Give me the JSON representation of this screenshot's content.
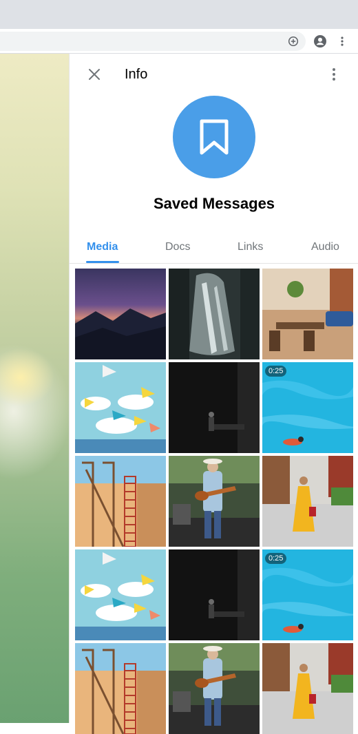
{
  "info": {
    "title": "Info",
    "name": "Saved Messages"
  },
  "tabs": [
    {
      "label": "Media",
      "active": true
    },
    {
      "label": "Docs",
      "active": false
    },
    {
      "label": "Links",
      "active": false
    },
    {
      "label": "Audio",
      "active": false
    }
  ],
  "media": [
    {
      "kind": "photo",
      "subject": "purple mountain sunset"
    },
    {
      "kind": "photo",
      "subject": "waterfall in forest"
    },
    {
      "kind": "photo",
      "subject": "restaurant interior"
    },
    {
      "kind": "photo",
      "subject": "colorful umbrellas in sky"
    },
    {
      "kind": "photo",
      "subject": "person in dark alley"
    },
    {
      "kind": "video",
      "subject": "swimmer in turquoise water",
      "duration": "0:25"
    },
    {
      "kind": "photo",
      "subject": "building with fire escape"
    },
    {
      "kind": "photo",
      "subject": "guitarist on stage"
    },
    {
      "kind": "photo",
      "subject": "woman in yellow dress on street"
    },
    {
      "kind": "photo",
      "subject": "colorful umbrellas in sky"
    },
    {
      "kind": "photo",
      "subject": "person in dark alley"
    },
    {
      "kind": "video",
      "subject": "swimmer in turquoise water",
      "duration": "0:25"
    },
    {
      "kind": "photo",
      "subject": "building with fire escape"
    },
    {
      "kind": "photo",
      "subject": "guitarist on stage"
    },
    {
      "kind": "photo",
      "subject": "woman in yellow dress on street"
    }
  ],
  "colors": {
    "accent": "#3390ec",
    "avatar": "#4a9ee8",
    "muted_text": "#707579"
  },
  "icons": [
    "close-icon",
    "more-vertical-icon",
    "bookmark-icon",
    "add-circle-icon",
    "account-circle-icon"
  ]
}
